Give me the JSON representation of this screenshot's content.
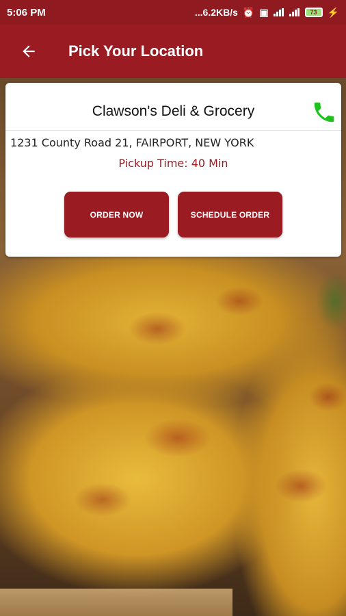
{
  "status_bar": {
    "time": "5:06 PM",
    "net_speed": "...6.2KB/s",
    "battery": "73"
  },
  "app_bar": {
    "back_icon": "arrow-left-icon",
    "title": "Pick Your Location"
  },
  "location": {
    "name": "Clawson's Deli & Grocery",
    "address": "1231 County Road 21, FAIRPORT, NEW YORK",
    "pickup_time": "Pickup Time: 40 Min",
    "phone_icon": "phone-icon",
    "order_now_label": "ORDER NOW",
    "schedule_order_label": "SCHEDULE ORDER"
  },
  "colors": {
    "primary": "#9a1c22",
    "status_bar": "#8f1a1f",
    "phone_icon": "#1fc21f"
  }
}
